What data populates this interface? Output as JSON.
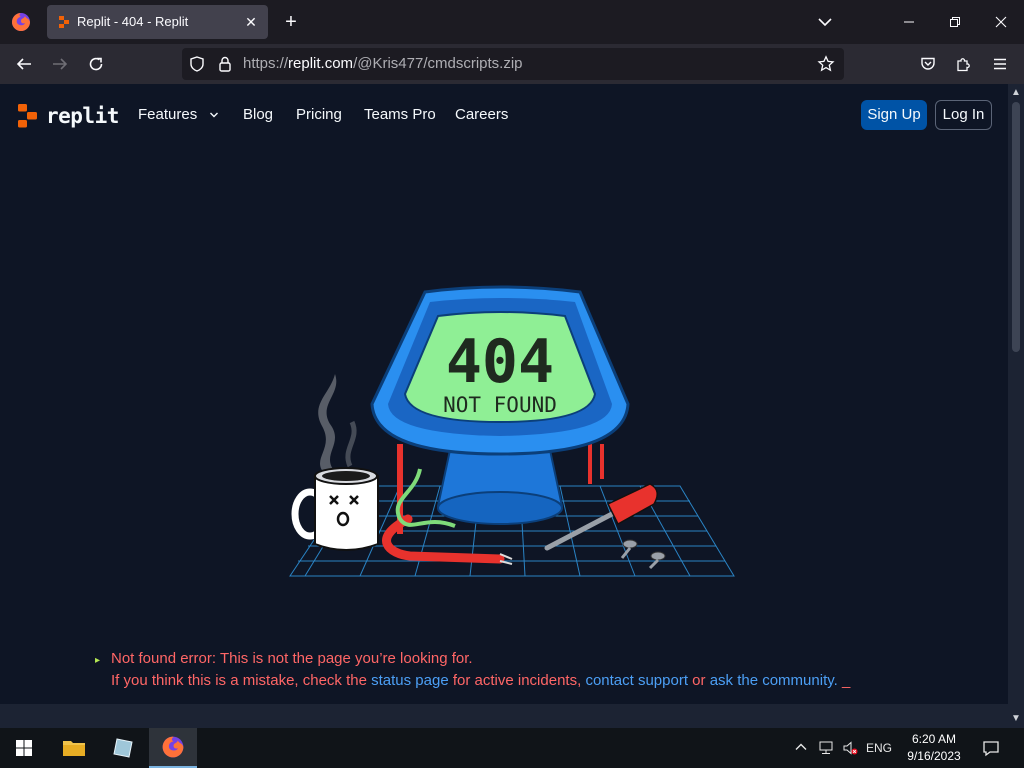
{
  "browser": {
    "tab_title": "Replit - 404 - Replit",
    "url_prefix": "https://",
    "url_host": "replit.com",
    "url_path": "/@Kris477/cmdscripts.zip"
  },
  "site": {
    "logo_text": "replit",
    "nav": [
      "Features",
      "Blog",
      "Pricing",
      "Teams Pro",
      "Careers"
    ],
    "signup_label": "Sign Up",
    "login_label": "Log In"
  },
  "illustration": {
    "display_code": "404",
    "display_text": "NOT FOUND"
  },
  "message": {
    "line1": "Not found error: This is not the page you’re looking for.",
    "line2_a": "If you think this is a mistake, check the",
    "status_link": "status page",
    "line2_b": "for active incidents,",
    "support_link": "contact support",
    "line2_c": "or",
    "community_link": "ask the community.",
    "cursor": "_"
  },
  "taskbar": {
    "lang": "ENG",
    "time": "6:20 AM",
    "date": "9/16/2023"
  },
  "colors": {
    "page_bg": "#0e1525",
    "error_text": "#ff6666",
    "link": "#4c9ff5",
    "signup_bg": "#0053a6",
    "brand_orange": "#f26207"
  }
}
